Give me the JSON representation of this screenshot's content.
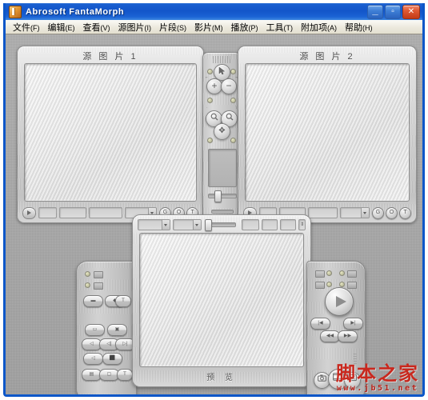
{
  "window": {
    "title": "Abrosoft FantaMorph",
    "icon": "app-icon",
    "buttons": {
      "minimize": "_",
      "maximize": "▫",
      "close": "✕"
    },
    "titlebar_color": "#1355c9",
    "client_bg": "#a9a9a9"
  },
  "menubar": [
    {
      "label": "文件",
      "mnemonic": "(F)"
    },
    {
      "label": "编辑",
      "mnemonic": "(E)"
    },
    {
      "label": "查看",
      "mnemonic": "(V)"
    },
    {
      "label": "源图片",
      "mnemonic": "(I)"
    },
    {
      "label": "片段",
      "mnemonic": "(S)"
    },
    {
      "label": "影片",
      "mnemonic": "(M)"
    },
    {
      "label": "播放",
      "mnemonic": "(P)"
    },
    {
      "label": "工具",
      "mnemonic": "(T)"
    },
    {
      "label": "附加项",
      "mnemonic": "(A)"
    },
    {
      "label": "帮助",
      "mnemonic": "(H)"
    }
  ],
  "source_panel_1": {
    "title": "源 图 片 1",
    "play_button": "play-icon",
    "fields": [
      "",
      "",
      "",
      ""
    ],
    "combo_value": "",
    "round_buttons": [
      "G",
      "O",
      "T"
    ]
  },
  "source_panel_2": {
    "title": "源 图 片 2",
    "play_button": "play-icon",
    "fields": [
      "",
      "",
      "",
      ""
    ],
    "combo_value": "",
    "round_buttons": [
      "G",
      "O",
      "T"
    ]
  },
  "center_controller": {
    "pointer_button": "cursor-arrow-icon",
    "zoom_in_button": "+",
    "zoom_out_button": "−",
    "magnifier_left": "⌕",
    "magnifier_right": "⌕",
    "move_button": "✥",
    "display_value": "",
    "slider_value": 38
  },
  "preview_panel": {
    "label": "预  览",
    "toolbar": {
      "combo_1": "",
      "combo_2": "",
      "slider_value": 8,
      "field_1": "",
      "field_2": "",
      "field_3": "",
      "spinner": "⇕"
    }
  },
  "left_wing": {
    "leds": [
      "led-1",
      "led-2"
    ],
    "buttons_row1": [
      "▬",
      "◆",
      "T"
    ],
    "buttons_row2": [
      "▭",
      "▣"
    ],
    "buttons_row3": [
      "◁",
      "◁|",
      "▷|"
    ],
    "buttons_row4": [
      "◁",
      "⬛"
    ],
    "buttons_row5": [
      "▤",
      "▢",
      "T"
    ]
  },
  "right_wing": {
    "leds_left": [
      "led-a",
      "led-b"
    ],
    "leds_right": [
      "grid-icon",
      "wave-icon"
    ],
    "play_button": "play-icon",
    "prev_button": "|◀",
    "next_button": "▶|",
    "step_back_button": "◀◀",
    "step_fwd_button": "▶▶",
    "bottom_buttons": [
      "camera-icon",
      "film-icon",
      "export-icon"
    ],
    "grip": "vertical-grip"
  },
  "watermark": {
    "main": "脚本之家",
    "sub": "www.jb51.net",
    "color": "#c9281e"
  }
}
